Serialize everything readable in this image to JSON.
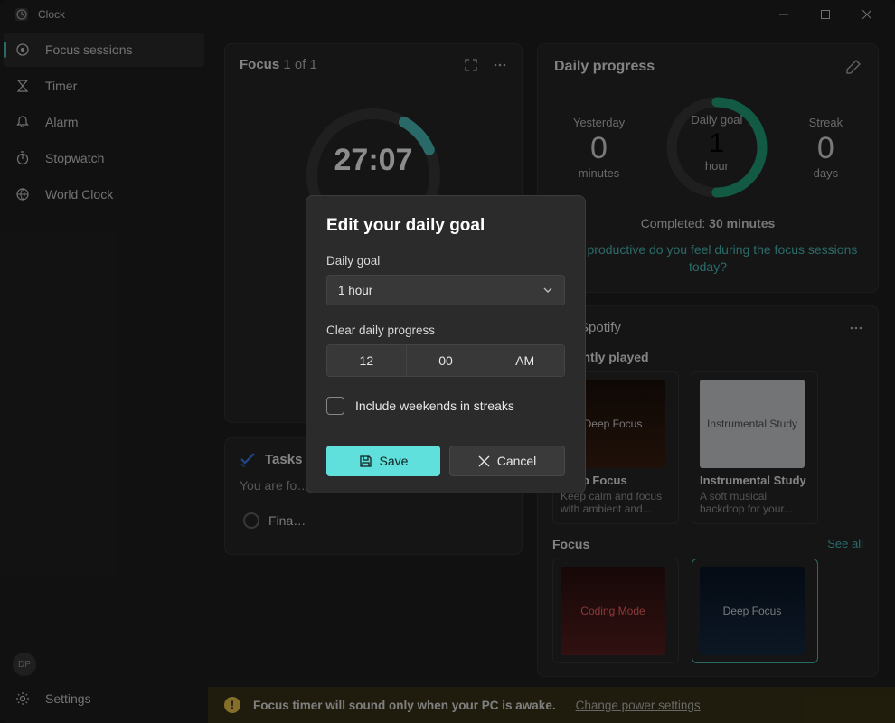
{
  "app": {
    "title": "Clock"
  },
  "window": {
    "minimize": "—",
    "maximize": "▢",
    "close": "✕"
  },
  "sidebar": {
    "items": [
      {
        "label": "Focus sessions",
        "icon": "focus"
      },
      {
        "label": "Timer",
        "icon": "timer"
      },
      {
        "label": "Alarm",
        "icon": "alarm"
      },
      {
        "label": "Stopwatch",
        "icon": "stopwatch"
      },
      {
        "label": "World Clock",
        "icon": "world"
      }
    ],
    "avatar": "DP",
    "settings": "Settings"
  },
  "focus": {
    "title_prefix": "Focus",
    "title_count": "1 of 1",
    "time": "27:07"
  },
  "tasks": {
    "title": "Tasks",
    "subtitle": "You are fo…",
    "item": "Fina…"
  },
  "daily": {
    "title": "Daily progress",
    "yesterday_label": "Yesterday",
    "yesterday_value": "0",
    "yesterday_unit": "minutes",
    "goal_label": "Daily goal",
    "goal_value": "1",
    "goal_unit": "hour",
    "streak_label": "Streak",
    "streak_value": "0",
    "streak_unit": "days",
    "completed_prefix": "Completed:",
    "completed_value": "30 minutes",
    "prompt": "How productive do you feel during the focus sessions today?"
  },
  "spotify": {
    "title": "Spotify",
    "recently": "Recently played",
    "playlists": [
      {
        "name": "Deep Focus",
        "art": "Deep Focus",
        "desc": "Keep calm and focus with ambient and..."
      },
      {
        "name": "Instrumental Study",
        "art": "Instrumental Study",
        "desc": "A soft musical backdrop for your..."
      }
    ],
    "focus_section": "Focus",
    "see_all": "See all",
    "focus_playlists": [
      {
        "art": "Coding Mode"
      },
      {
        "art": "Deep Focus"
      }
    ]
  },
  "modal": {
    "title": "Edit your daily goal",
    "daily_goal_label": "Daily goal",
    "daily_goal_value": "1 hour",
    "clear_label": "Clear daily progress",
    "hour": "12",
    "minute": "00",
    "ampm": "AM",
    "checkbox": "Include weekends in streaks",
    "save": "Save",
    "cancel": "Cancel"
  },
  "banner": {
    "text": "Focus timer will sound only when your PC is awake.",
    "link": "Change power settings"
  }
}
